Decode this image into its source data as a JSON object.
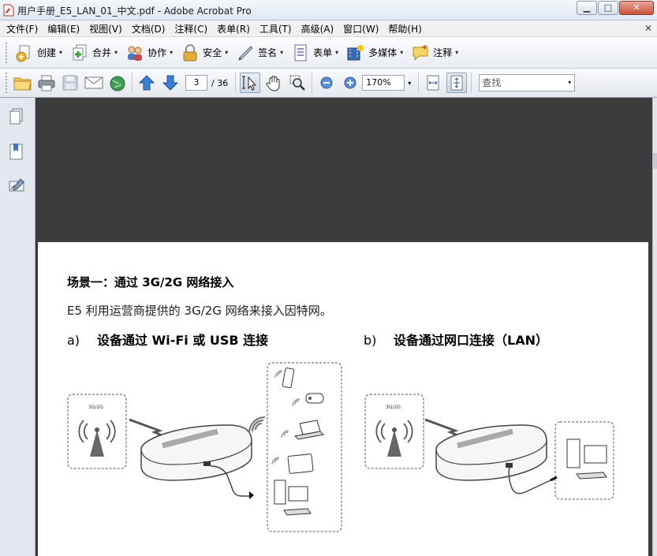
{
  "window": {
    "title": "用户手册_E5_LAN_01_中文.pdf - Adobe Acrobat Pro",
    "controls": {
      "minimize": "▁",
      "maximize": "□",
      "close": "✕"
    }
  },
  "menu": {
    "items": [
      "文件(F)",
      "编辑(E)",
      "视图(V)",
      "文档(D)",
      "注释(C)",
      "表单(R)",
      "工具(T)",
      "高级(A)",
      "窗口(W)",
      "帮助(H)"
    ],
    "close_glyph": "✕"
  },
  "task_toolbar": {
    "items": [
      {
        "label": "创建",
        "icon": "create-icon"
      },
      {
        "label": "合并",
        "icon": "combine-icon"
      },
      {
        "label": "协作",
        "icon": "collaborate-icon"
      },
      {
        "label": "安全",
        "icon": "lock-icon"
      },
      {
        "label": "签名",
        "icon": "pen-icon"
      },
      {
        "label": "表单",
        "icon": "form-icon"
      },
      {
        "label": "多媒体",
        "icon": "multimedia-icon"
      },
      {
        "label": "注释",
        "icon": "comment-icon"
      }
    ],
    "dropdown_glyph": "▾"
  },
  "nav_toolbar": {
    "current_page": "3",
    "total_pages": "/ 36",
    "zoom": "170%",
    "search_placeholder": "查找",
    "dropdown_glyph": "▾"
  },
  "document": {
    "heading": "场景一：通过 3G/2G 网络接入",
    "paragraph": "E5 利用运营商提供的 3G/2G 网络来接入因特网。",
    "scenario_a": {
      "marker": "a)",
      "text": "设备通过 Wi-Fi 或 USB 连接"
    },
    "scenario_b": {
      "marker": "b)",
      "text": "设备通过网口连接（LAN）"
    },
    "network_label": "3G/2G"
  },
  "colors": {
    "doc_background": "#3c3c3c",
    "page": "#ffffff",
    "toolbar": "#e9edf2"
  }
}
